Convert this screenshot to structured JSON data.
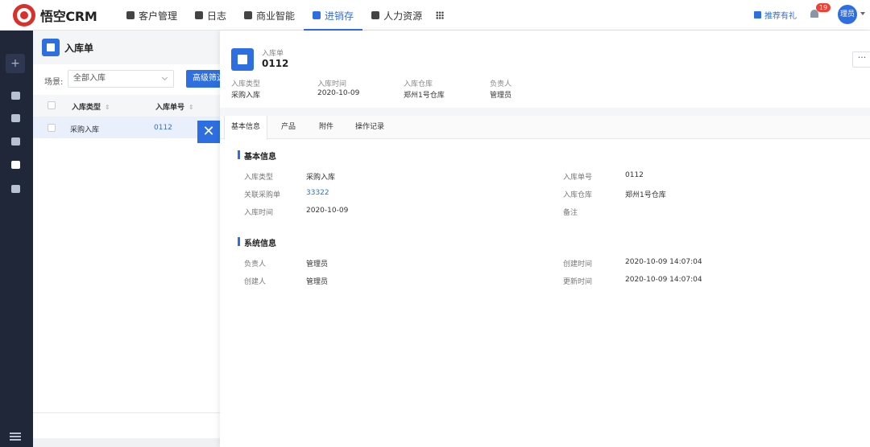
{
  "app": {
    "logo_text": "悟空CRM"
  },
  "nav": {
    "items": [
      {
        "label": "客户管理"
      },
      {
        "label": "日志"
      },
      {
        "label": "商业智能"
      },
      {
        "label": "进销存"
      },
      {
        "label": "人力资源"
      }
    ],
    "active_index": 3,
    "gift_label": "推荐有礼",
    "notification_count": "19",
    "avatar_text": "理员"
  },
  "sidebar": {
    "add_label": "+"
  },
  "list": {
    "title": "入库单",
    "scene_label": "场景:",
    "scene_value": "全部入库",
    "advanced_label": "高级筛选",
    "columns": [
      "入库类型",
      "入库单号"
    ],
    "rows": [
      {
        "type": "采购入库",
        "number": "0112"
      }
    ]
  },
  "detail": {
    "header_label": "入库单",
    "header_title": "0112",
    "more_label": "···",
    "summary": [
      {
        "label": "入库类型",
        "value": "采购入库"
      },
      {
        "label": "入库时间",
        "value": "2020-10-09"
      },
      {
        "label": "入库仓库",
        "value": "郑州1号仓库"
      },
      {
        "label": "负责人",
        "value": "管理员"
      }
    ],
    "tabs": [
      "基本信息",
      "产品",
      "附件",
      "操作记录"
    ],
    "basic_title": "基本信息",
    "basic_fields": {
      "type_label": "入库类型",
      "type_value": "采购入库",
      "po_label": "关联采购单",
      "po_value": "33322",
      "time_label": "入库时间",
      "time_value": "2020-10-09",
      "no_label": "入库单号",
      "no_value": "0112",
      "wh_label": "入库仓库",
      "wh_value": "郑州1号仓库",
      "remark_label": "备注",
      "remark_value": ""
    },
    "system_title": "系统信息",
    "system_fields": {
      "owner_label": "负责人",
      "owner_value": "管理员",
      "creator_label": "创建人",
      "creator_value": "管理员",
      "created_label": "创建时间",
      "created_value": "2020-10-09 14:07:04",
      "updated_label": "更新时间",
      "updated_value": "2020-10-09 14:07:04"
    }
  }
}
